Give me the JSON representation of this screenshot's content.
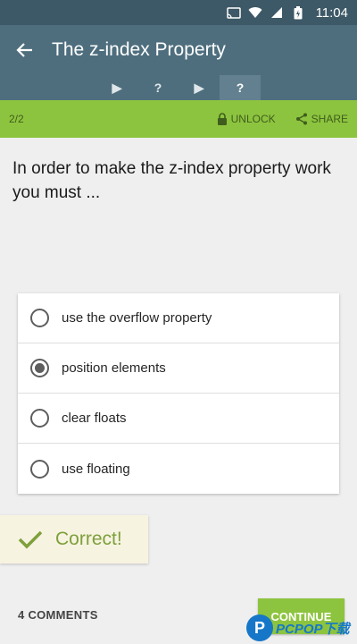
{
  "status_bar": {
    "time": "11:04"
  },
  "app_bar": {
    "title": "The z-index Property"
  },
  "steps": [
    {
      "label": "▶",
      "active": false
    },
    {
      "label": "?",
      "active": false
    },
    {
      "label": "▶",
      "active": false
    },
    {
      "label": "?",
      "active": true
    }
  ],
  "lesson_bar": {
    "progress": "2/2",
    "unlock_label": "UNLOCK",
    "share_label": "SHARE"
  },
  "question": {
    "text": "In order to make the z-index property work you must ..."
  },
  "options": [
    {
      "text": "use the overflow property",
      "selected": false
    },
    {
      "text": "position elements",
      "selected": true
    },
    {
      "text": "clear floats",
      "selected": false
    },
    {
      "text": "use floating",
      "selected": false
    }
  ],
  "feedback": {
    "text": "Correct!"
  },
  "footer": {
    "comments_label": "4 COMMENTS",
    "continue_label": "CONTINUE"
  },
  "watermark": {
    "text": "PCPOP下载"
  },
  "colors": {
    "app_bar": "#4e6e7e",
    "accent_green": "#8dc43f",
    "correct_text": "#7ea03b"
  }
}
